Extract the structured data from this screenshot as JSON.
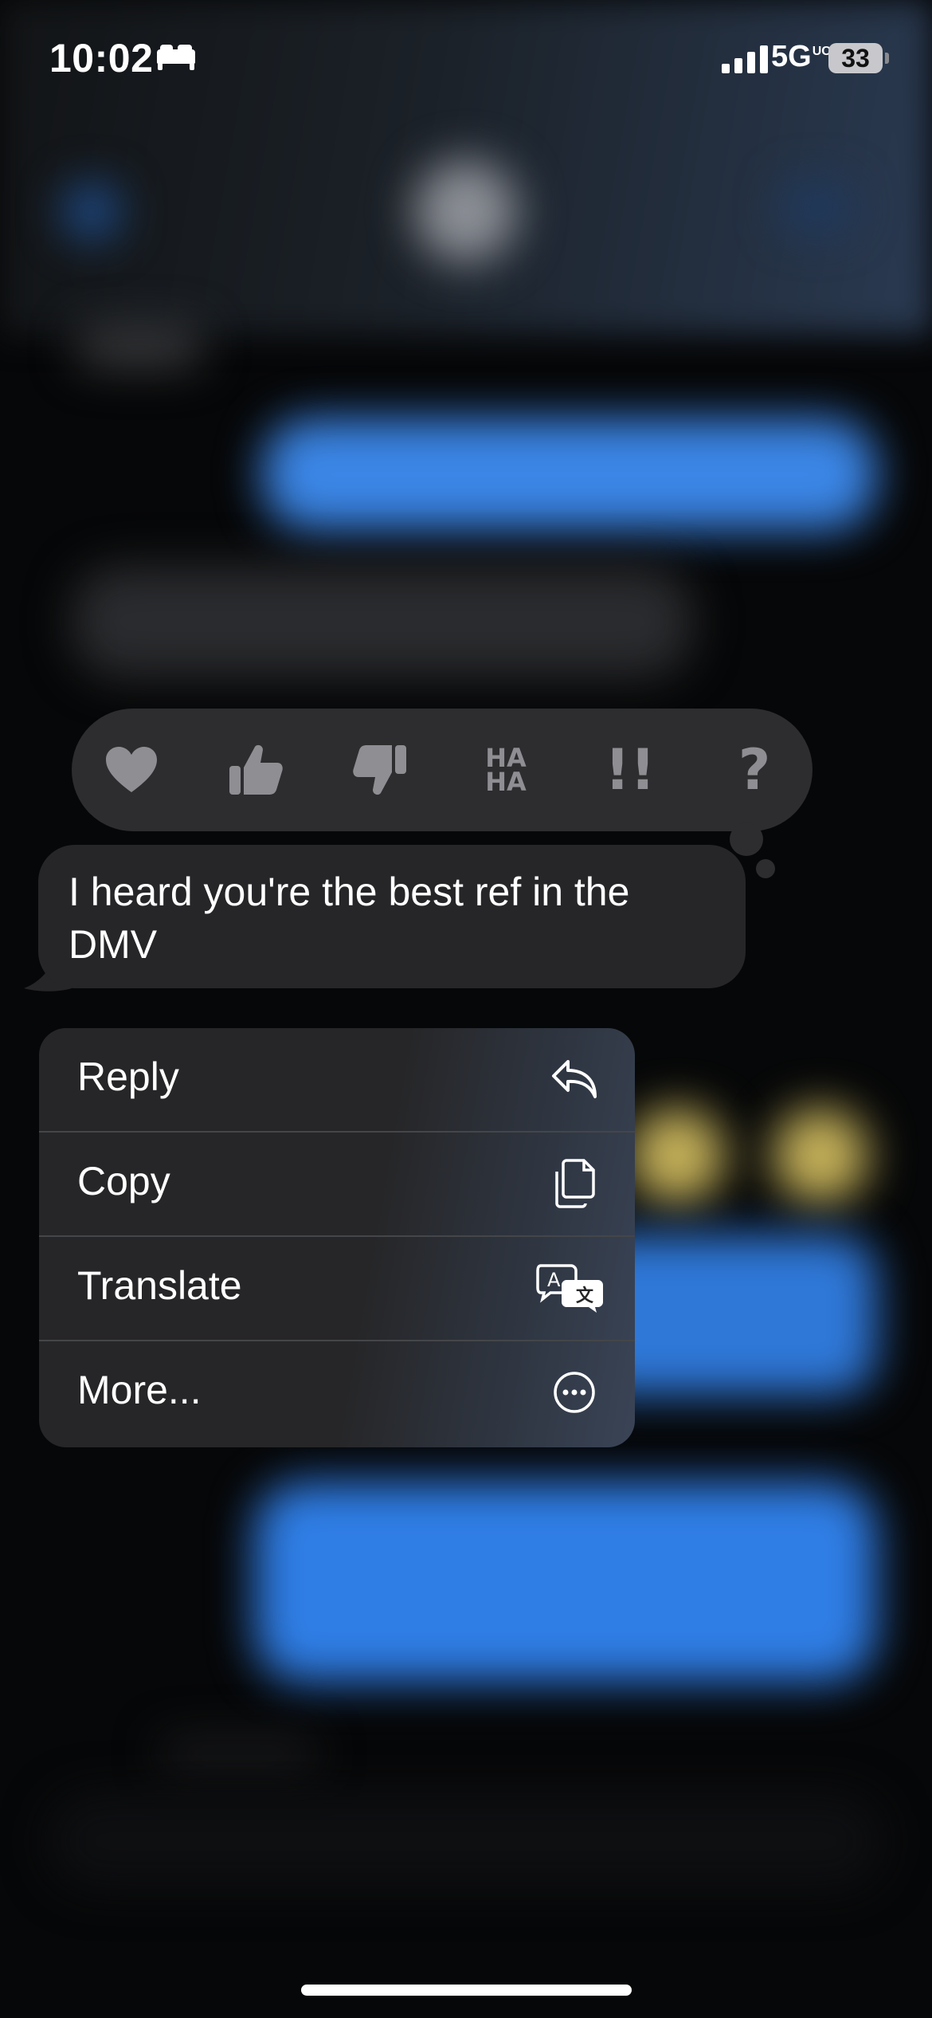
{
  "status_bar": {
    "time": "10:02",
    "network": "5G",
    "network_suffix": "UC",
    "battery": "33"
  },
  "reactions": [
    {
      "name": "heart-reaction",
      "icon": "heart-icon"
    },
    {
      "name": "thumbs-up-reaction",
      "icon": "thumbs-up-icon"
    },
    {
      "name": "thumbs-down-reaction",
      "icon": "thumbs-down-icon"
    },
    {
      "name": "haha-reaction",
      "line1": "HA",
      "line2": "HA"
    },
    {
      "name": "exclamation-reaction",
      "text": "!!"
    },
    {
      "name": "question-reaction",
      "text": "?"
    }
  ],
  "message": {
    "text": "I heard you're the best ref in the DMV"
  },
  "menu": {
    "items": [
      {
        "label": "Reply",
        "icon": "reply-icon"
      },
      {
        "label": "Copy",
        "icon": "copy-icon"
      },
      {
        "label": "Translate",
        "icon": "translate-icon"
      },
      {
        "label": "More...",
        "icon": "more-icon"
      }
    ]
  },
  "colors": {
    "reaction_bar_bg": "#2d2d2f",
    "bubble_bg": "#262629",
    "reaction_icon": "#8e8e93",
    "blurred_blue": "#3b86e6"
  }
}
